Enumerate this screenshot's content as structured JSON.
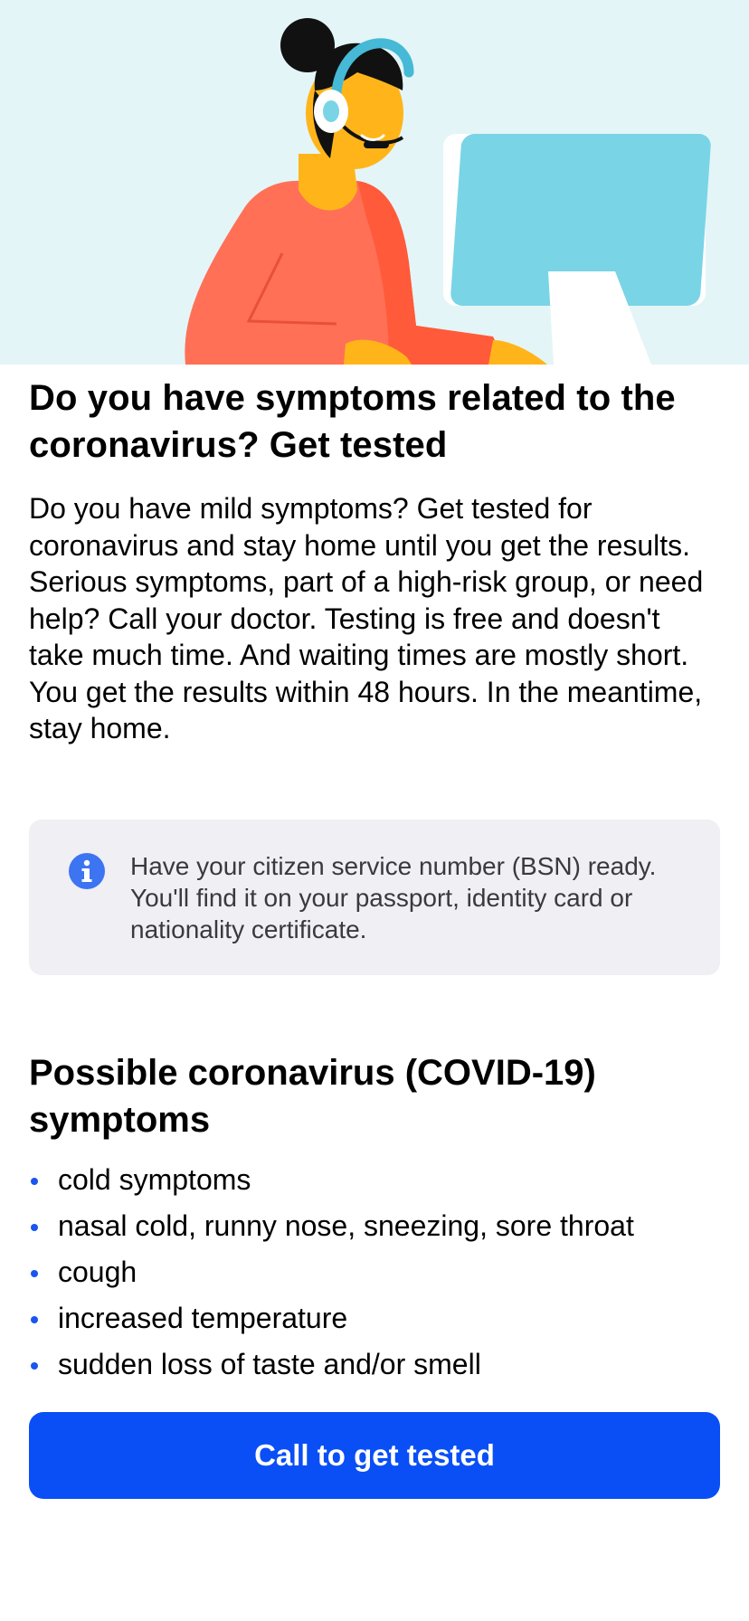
{
  "header": {
    "illustration_icon": "support-agent-at-computer-illustration"
  },
  "main": {
    "title": "Do you have symptoms related to the coronavirus? Get tested",
    "body": "Do you have mild symptoms? Get tested for coronavirus and stay home until you get the results. Serious symptoms, part of a high-risk group, or need help? Call your doctor. Testing is free and doesn't take much time. And waiting times are mostly short. You get the results within 48 hours. In the meantime, stay home."
  },
  "info": {
    "icon": "info-icon",
    "text": "Have your citizen service number (BSN) ready. You'll find it on your passport, identity card or nationality certificate."
  },
  "symptoms": {
    "title": "Possible coronavirus (COVID-19) symptoms",
    "items": [
      "cold symptoms",
      "nasal cold, runny nose, sneezing, sore throat",
      "cough",
      "increased temperature",
      "sudden loss of taste and/or smell"
    ]
  },
  "actions": {
    "call_label": "Call to get tested"
  },
  "colors": {
    "accent": "#0a4ff5",
    "hero_background": "#e3f5f7",
    "info_background": "#efeff4",
    "bullet": "#1a55f0"
  }
}
